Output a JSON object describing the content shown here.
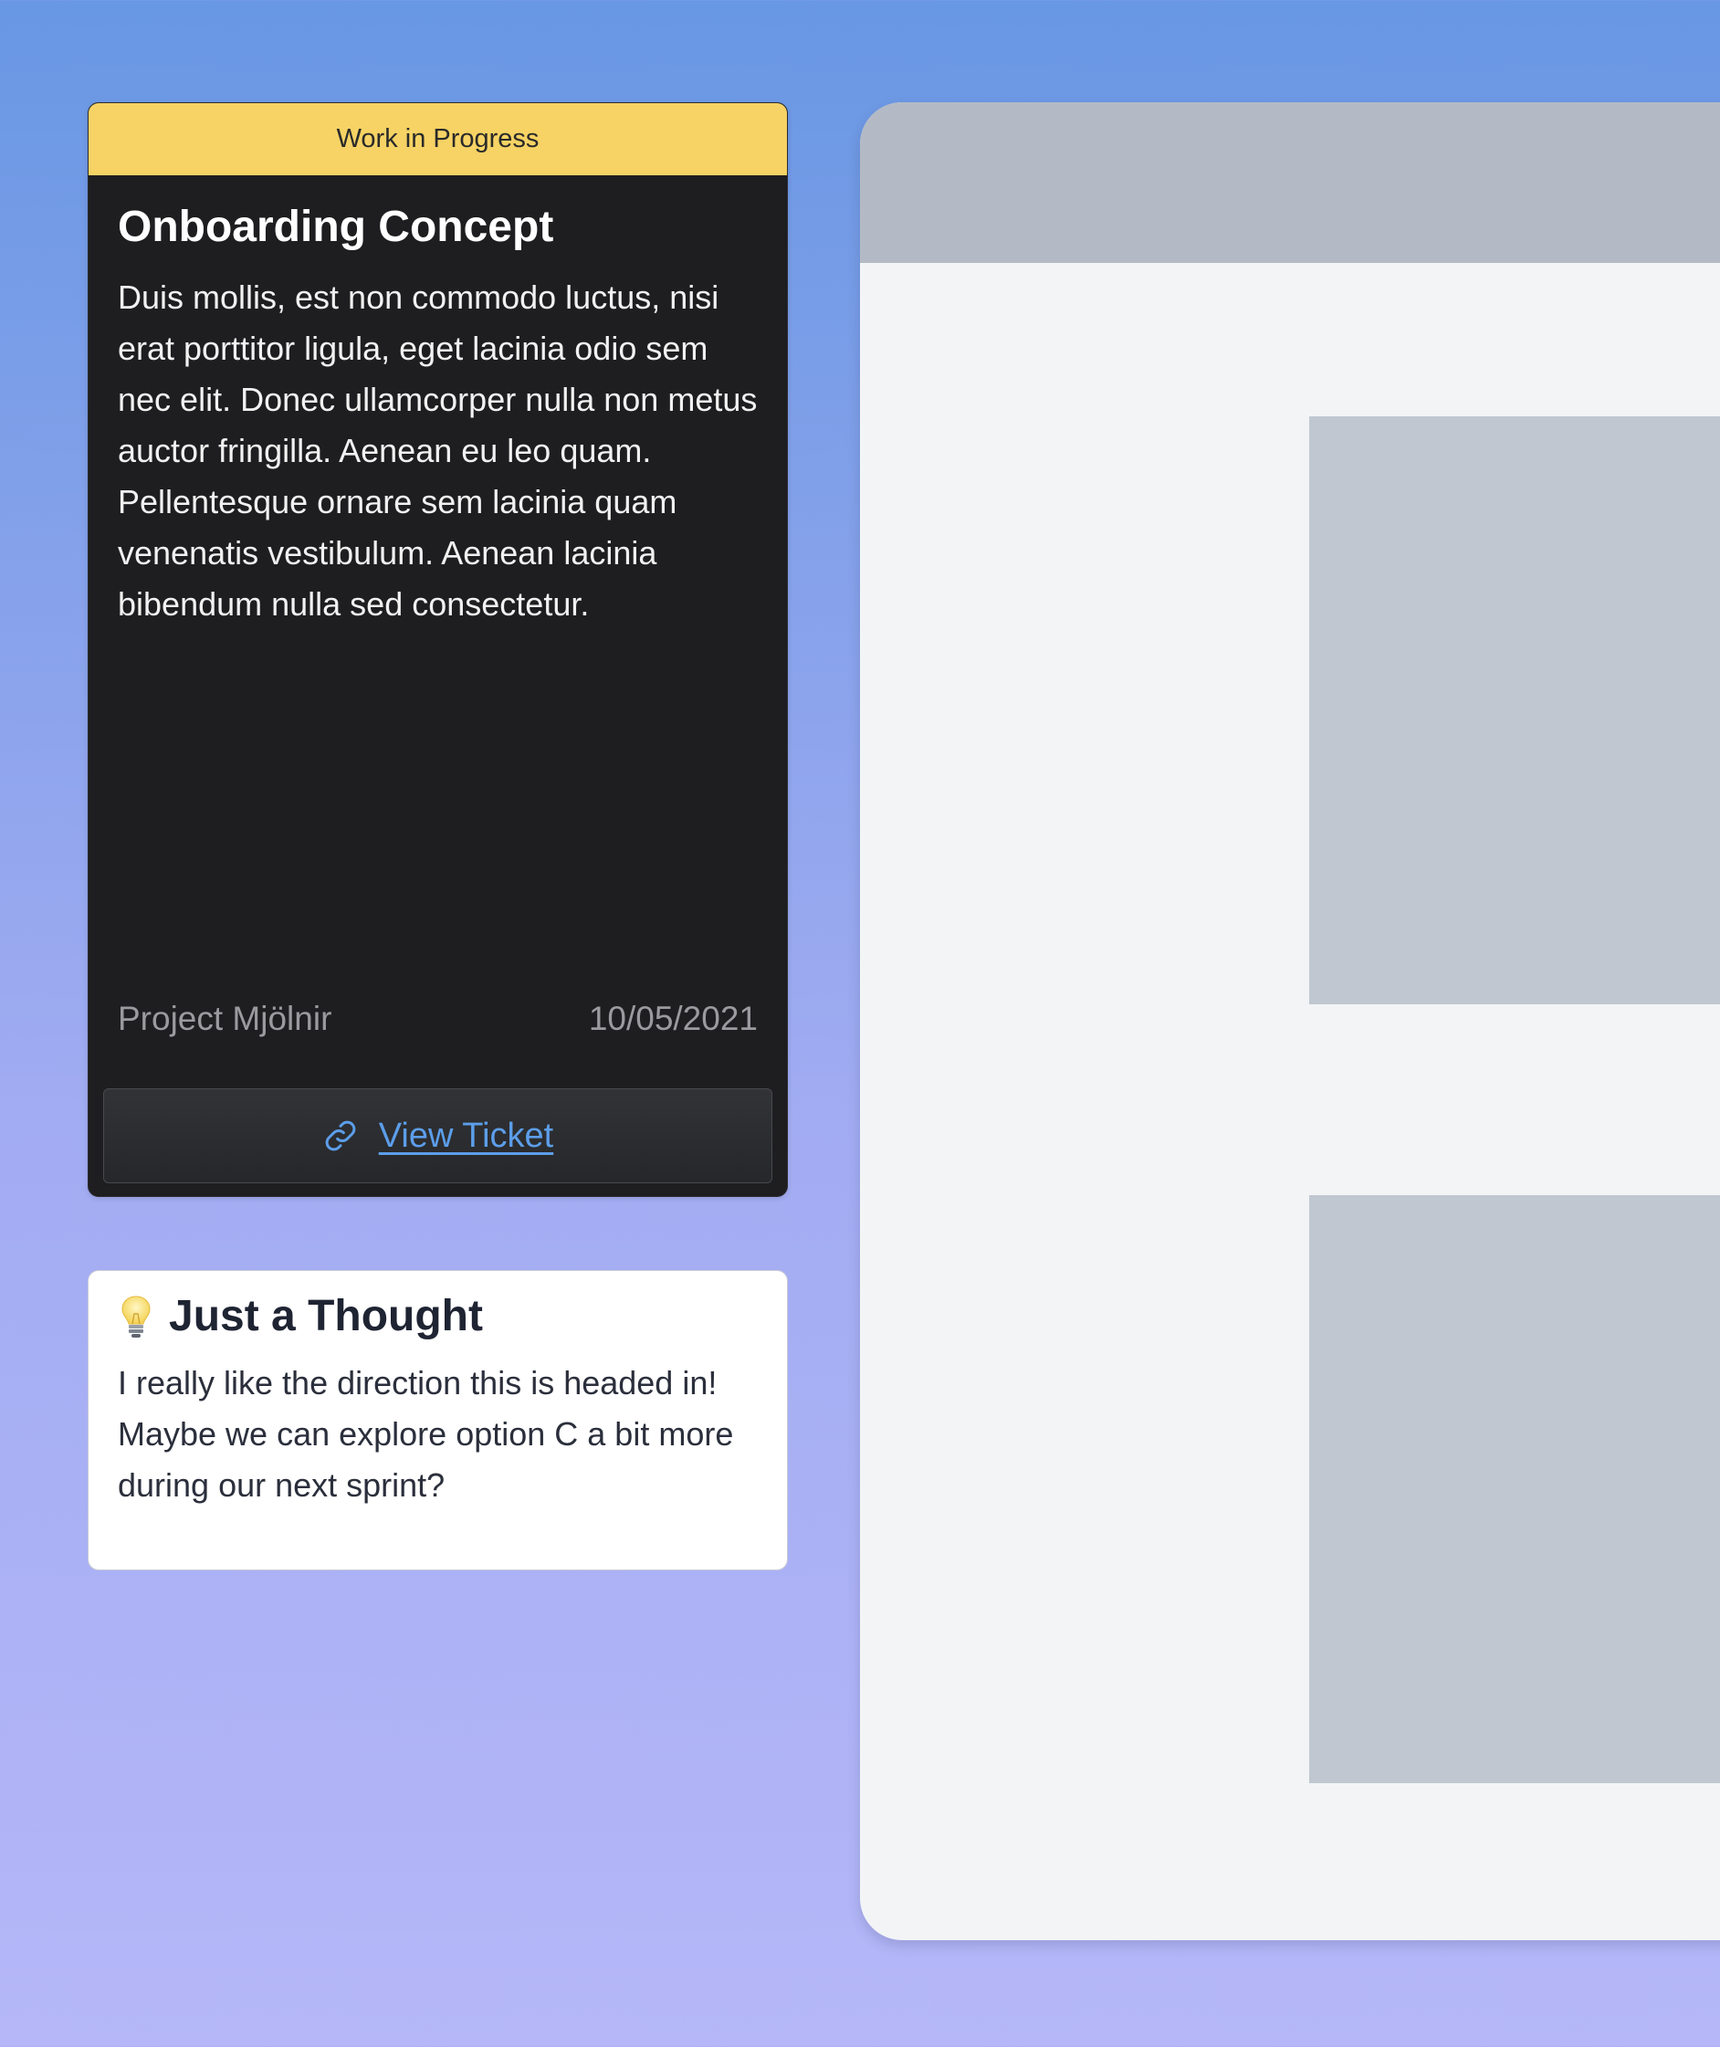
{
  "task_card": {
    "status": "Work in Progress",
    "title": "Onboarding Concept",
    "description": "Duis mollis, est non commodo luctus, nisi erat porttitor ligula, eget lacinia odio sem nec elit. Donec ullamcorper nulla non metus auctor fringilla. Aenean eu leo quam. Pellentesque ornare sem lacinia quam venenatis vestibulum. Aenean lacinia bibendum nulla sed consectetur.",
    "project": "Project Mjölnir",
    "date": "10/05/2021",
    "action": {
      "icon": "link-icon",
      "label": "View Ticket"
    }
  },
  "note_card": {
    "icon": "lightbulb-icon",
    "title": "Just a Thought",
    "body": "I really like the direction this is headed in! Maybe we can explore option C a bit more during our next sprint?"
  },
  "colors": {
    "status_banner": "#f6d364",
    "card_background": "#1e1e20",
    "link": "#5c9eea"
  }
}
